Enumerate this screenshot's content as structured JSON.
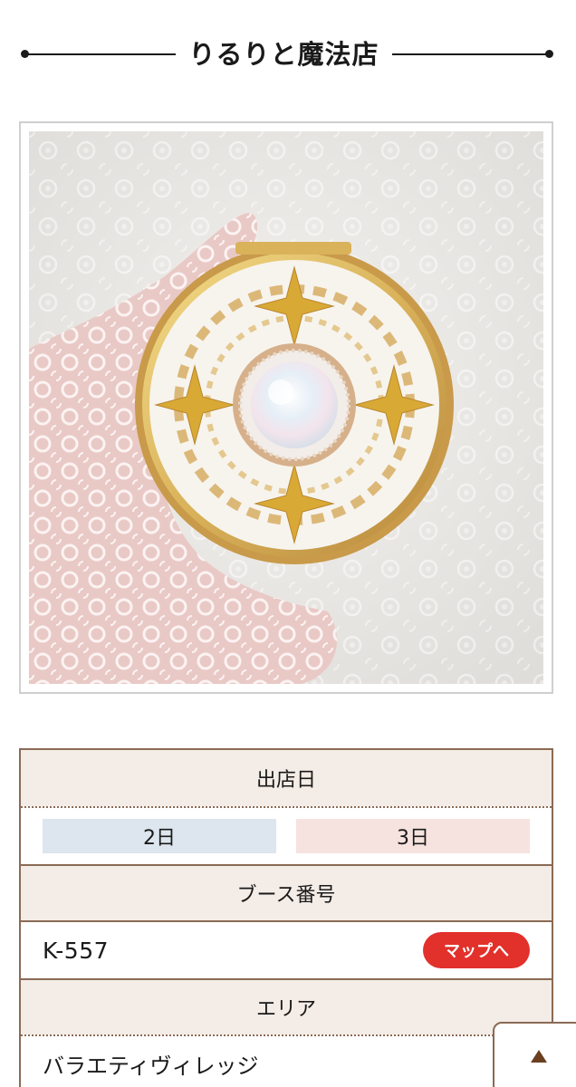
{
  "shop": {
    "name": "りるりと魔法店"
  },
  "info": {
    "days_header": "出店日",
    "days": [
      "2日",
      "3日"
    ],
    "booth_header": "ブース番号",
    "booth_number": "K-557",
    "map_button": "マップへ",
    "area_header": "エリア",
    "area_value": "バラエティヴィレッジ"
  },
  "colors": {
    "accent_red": "#e2302b",
    "table_border": "#8a6a55",
    "header_bg": "#f4ece6",
    "day2_bg": "#dde6ee",
    "day3_bg": "#f6e3df"
  },
  "icons": {
    "back_to_top": "triangle-up-icon"
  }
}
